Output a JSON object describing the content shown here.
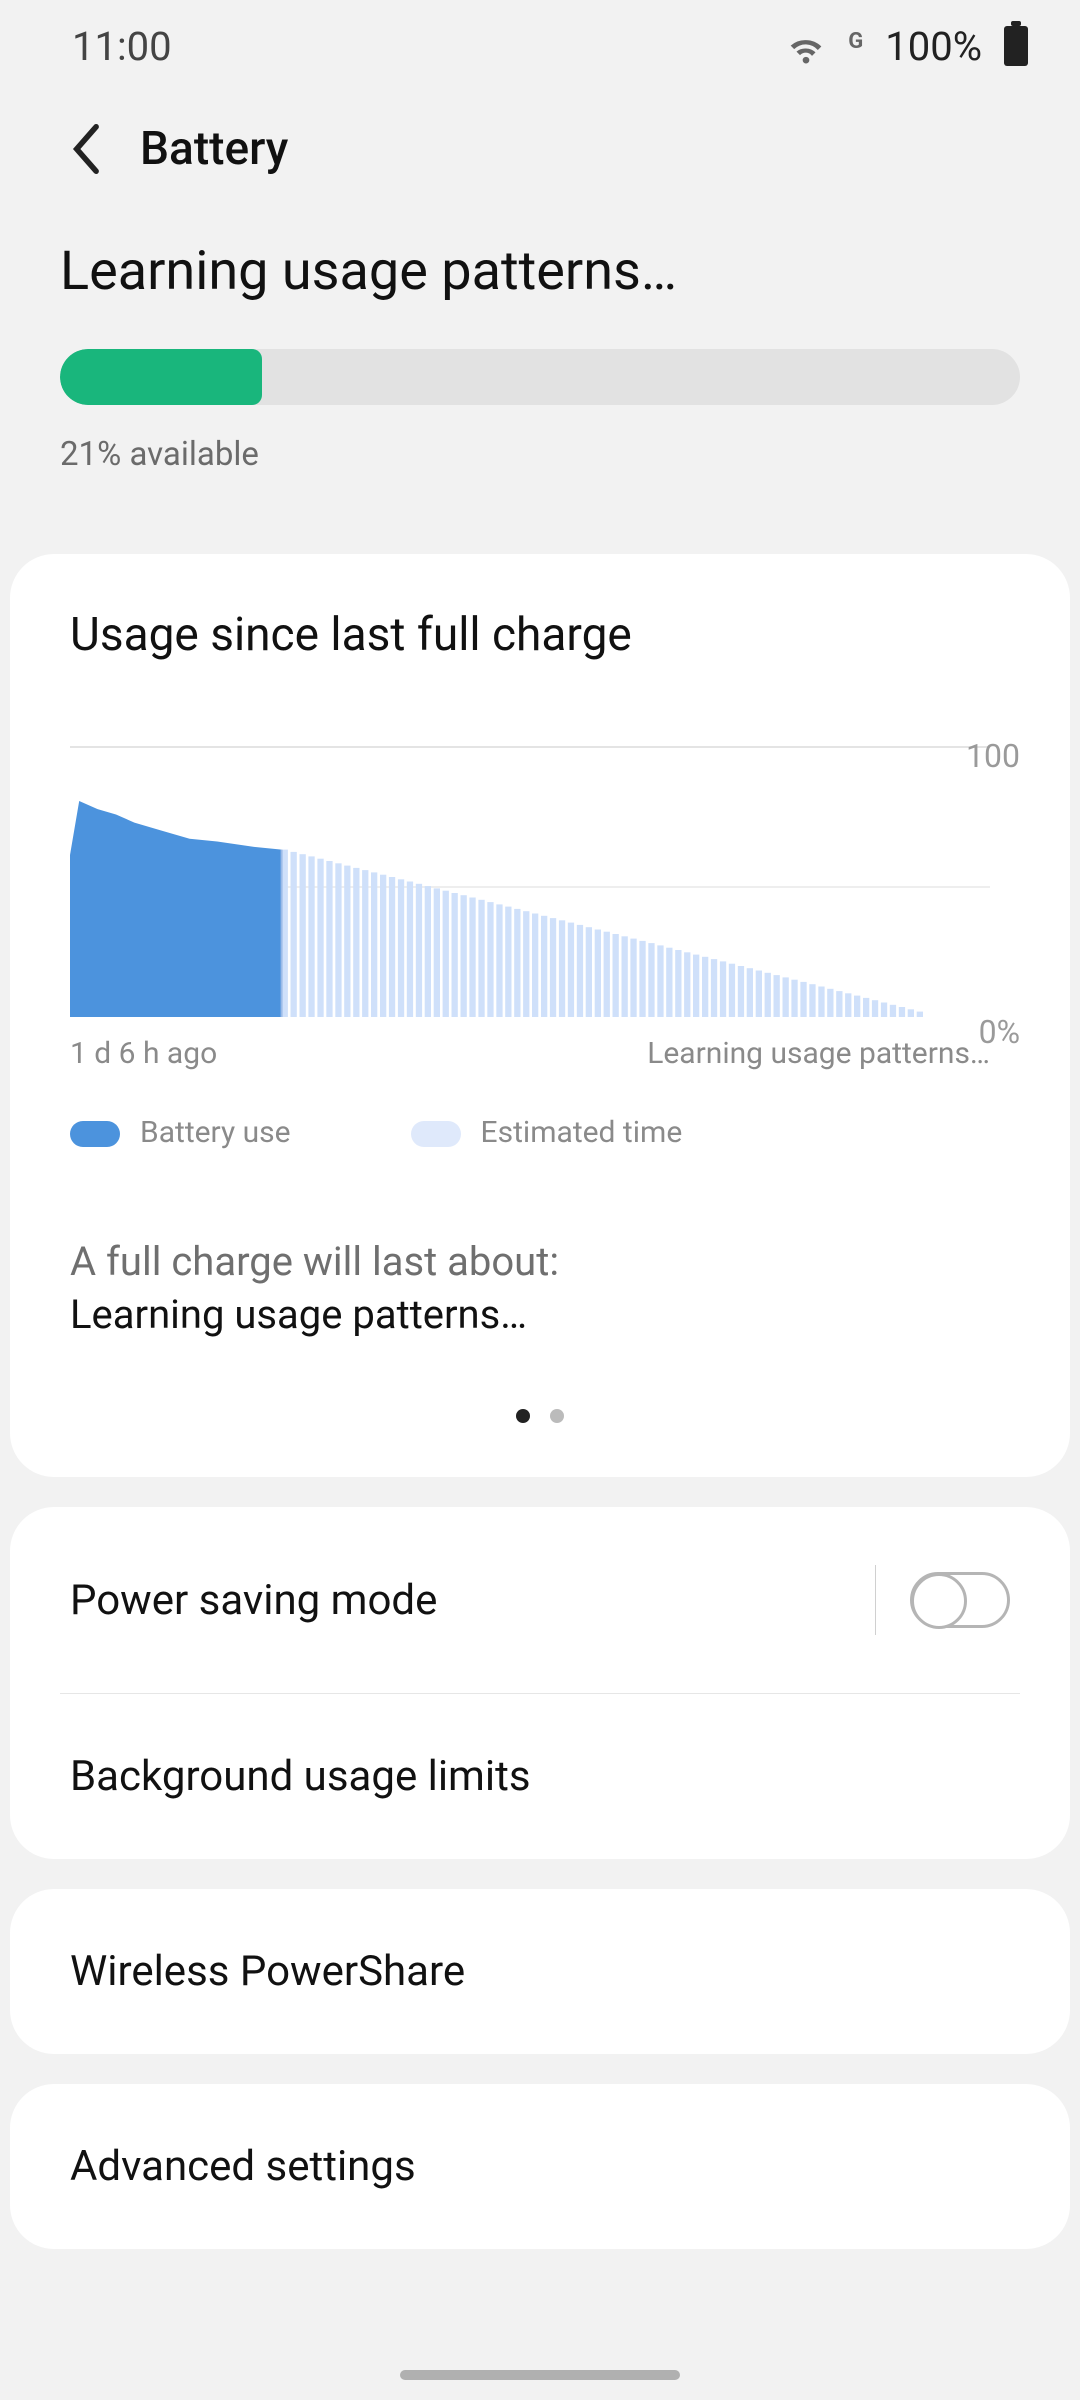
{
  "status": {
    "time": "11:00",
    "net_label": "G",
    "battery_pct": "100%"
  },
  "appbar": {
    "title": "Battery"
  },
  "hero": {
    "learning": "Learning usage patterns…",
    "battery_pct": 21,
    "available_text": "21% available"
  },
  "usage_card": {
    "title": "Usage since last full charge",
    "x_left": "1 d 6 h ago",
    "x_right": "Learning usage patterns…",
    "y_top": "100",
    "y_bottom": "0%",
    "legend_use": "Battery use",
    "legend_est": "Estimated time",
    "est_line1": "A full charge will last about:",
    "est_line2": "Learning usage patterns…"
  },
  "chart_data": {
    "type": "area",
    "xlabel": "",
    "ylabel": "",
    "ylim": [
      0,
      100
    ],
    "x_extent_label_left": "1 d 6 h ago",
    "x_extent_label_right": "Learning usage patterns…",
    "series": [
      {
        "name": "Battery use",
        "color": "#4c93dd",
        "x": [
          0,
          0.01,
          0.03,
          0.05,
          0.07,
          0.1,
          0.13,
          0.16,
          0.2,
          0.23
        ],
        "values": [
          60,
          80,
          77,
          75,
          72,
          69,
          66,
          65,
          63,
          62
        ]
      },
      {
        "name": "Estimated time",
        "color": "#cfe0fa",
        "x": [
          0.23,
          0.4,
          0.6,
          0.8,
          0.93
        ],
        "values": [
          62,
          48,
          32,
          15,
          2
        ]
      }
    ]
  },
  "rows": {
    "power_saving": "Power saving mode",
    "bg_limits": "Background usage limits",
    "powershare": "Wireless PowerShare",
    "advanced": "Advanced settings"
  }
}
